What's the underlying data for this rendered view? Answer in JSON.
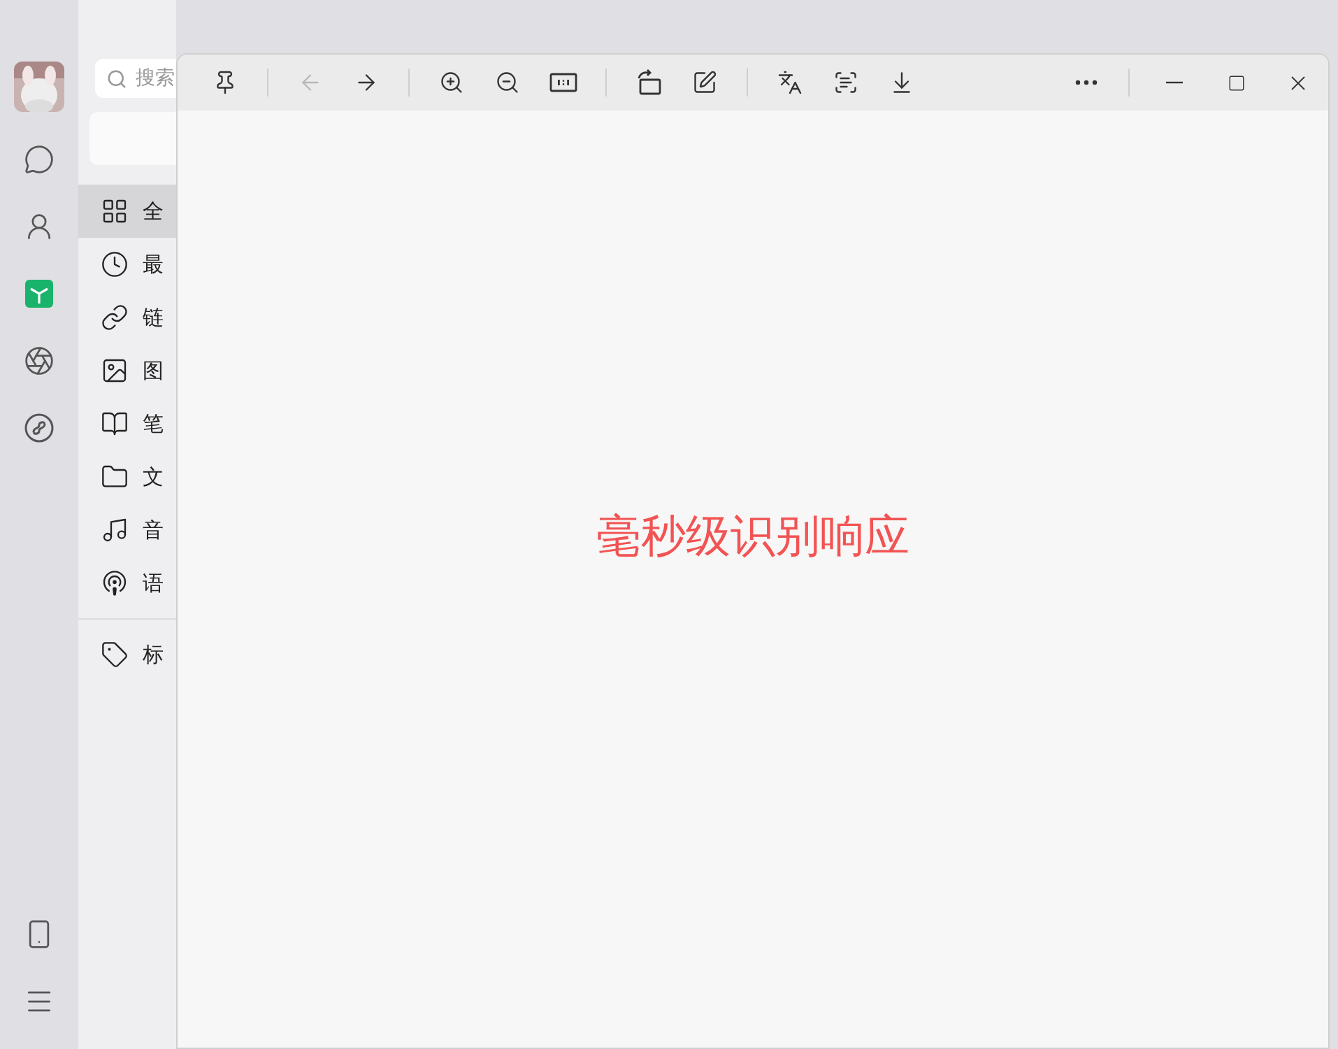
{
  "sidebar": {
    "search": {
      "placeholder": "搜索"
    },
    "items": [
      {
        "label": "全",
        "selected": true
      },
      {
        "label": "最",
        "selected": false
      },
      {
        "label": "链",
        "selected": false
      },
      {
        "label": "图",
        "selected": false
      },
      {
        "label": "笔",
        "selected": false
      },
      {
        "label": "文",
        "selected": false
      },
      {
        "label": "音",
        "selected": false
      },
      {
        "label": "语",
        "selected": false
      }
    ],
    "tag_items": [
      {
        "label": "标",
        "selected": false
      }
    ]
  },
  "viewer": {
    "toolbar_groups": [
      [
        {
          "disabled": false
        }
      ],
      [
        {
          "disabled": true
        },
        {
          "disabled": false
        }
      ],
      [
        {
          "disabled": false
        },
        {
          "disabled": false
        },
        {
          "disabled": false
        }
      ],
      [
        {
          "disabled": false
        },
        {
          "disabled": false
        }
      ],
      [
        {
          "disabled": false
        },
        {
          "disabled": false
        },
        {
          "disabled": false
        }
      ]
    ],
    "recognized_text": "毫秒级识别响应"
  }
}
